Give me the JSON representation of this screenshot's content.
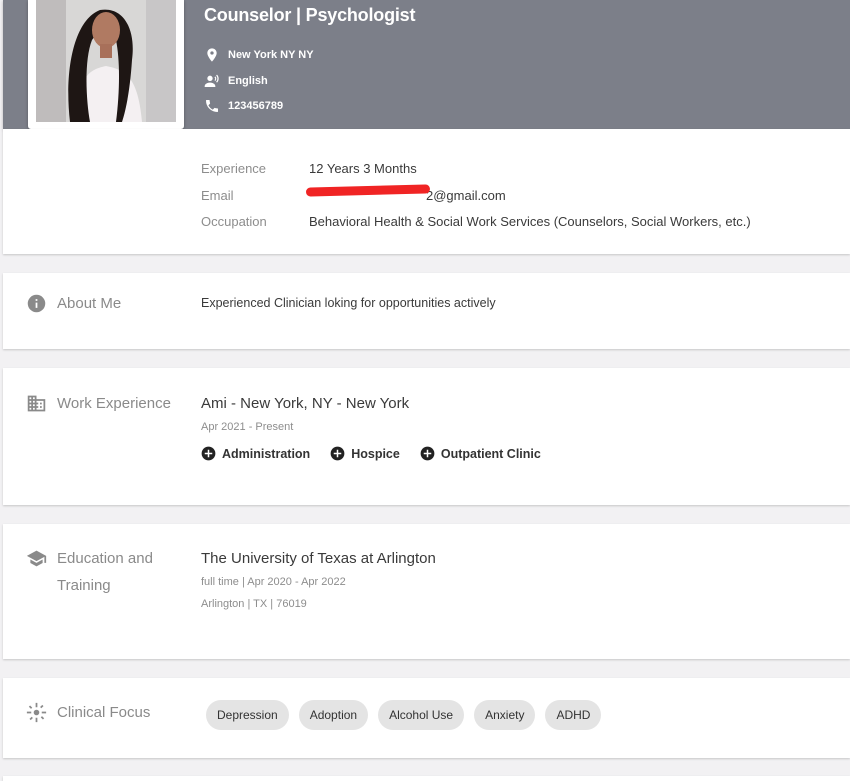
{
  "profile": {
    "title": "Counselor | Psychologist",
    "location": "New York NY NY",
    "language": "English",
    "phone": "123456789"
  },
  "details": [
    {
      "label": "Experience",
      "value": "12 Years 3 Months"
    },
    {
      "label": "Email",
      "value": "2@gmail.com"
    },
    {
      "label": "Occupation",
      "value": "Behavioral Health & Social Work Services (Counselors, Social Workers, etc.)"
    }
  ],
  "about": {
    "label": "About Me",
    "text": "Experienced Clinician loking for opportunities actively"
  },
  "work": {
    "label": "Work Experience",
    "title": "Ami - New York, NY - New York",
    "dates": "Apr 2021 - Present",
    "tags": [
      "Administration",
      "Hospice",
      "Outpatient Clinic"
    ]
  },
  "education": {
    "label_line1": "Education and",
    "label_line2": "Training",
    "school": "The University of Texas at Arlington",
    "meta": "full time | Apr 2020 - Apr 2022",
    "location": "Arlington | TX | 76019"
  },
  "clinical": {
    "label": "Clinical Focus",
    "chips": [
      "Depression",
      "Adoption",
      "Alcohol Use",
      "Anxiety",
      "ADHD"
    ]
  }
}
